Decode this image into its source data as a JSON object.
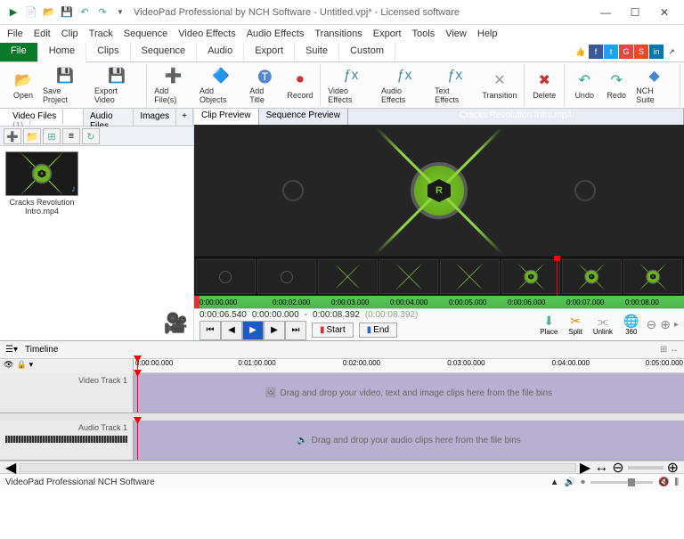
{
  "app": {
    "title": "VideoPad Professional by NCH Software - Untitled.vpj* - Licensed software"
  },
  "menu": [
    "File",
    "Edit",
    "Clip",
    "Track",
    "Sequence",
    "Video Effects",
    "Audio Effects",
    "Transitions",
    "Export",
    "Tools",
    "View",
    "Help"
  ],
  "tabs": {
    "file": "File",
    "items": [
      "Home",
      "Clips",
      "Sequence",
      "Audio",
      "Export",
      "Suite",
      "Custom"
    ],
    "active": "Home"
  },
  "ribbon": {
    "open": "Open",
    "save": "Save Project",
    "export": "Export Video",
    "addfiles": "Add File(s)",
    "addobj": "Add Objects",
    "addtitle": "Add Title",
    "record": "Record",
    "vfx": "Video Effects",
    "afx": "Audio Effects",
    "tfx": "Text Effects",
    "trans": "Transition",
    "delete": "Delete",
    "undo": "Undo",
    "redo": "Redo",
    "suite": "NCH Suite"
  },
  "bins": {
    "tabs": {
      "video": "Video Files",
      "video_count": "(1)",
      "audio": "Audio Files",
      "images": "Images"
    },
    "clip": {
      "name": "Cracks Revolution Intro.mp4"
    }
  },
  "preview": {
    "tabs": {
      "clip": "Clip Preview",
      "seq": "Sequence Preview"
    },
    "title": "Cracks Revolution Intro.mp4",
    "ruler": [
      "0:00:00.000",
      "0:00:02.000",
      "0:00:03.000",
      "0:00:04.000",
      "0:00:05.000",
      "0:00:06.000",
      "0:00:07.000",
      "0:00:08.00"
    ],
    "time": {
      "pos": "0:00:06.540",
      "in": "0:00:00.000",
      "out": "0:00:08.392",
      "dur": "(0:00:08.392)"
    },
    "start": "Start",
    "end": "End",
    "place": "Place",
    "split": "Split",
    "unlink": "Unlink",
    "v360": "360"
  },
  "timeline": {
    "label": "Timeline",
    "ruler": [
      "0:00:00.000",
      "0:01:00.000",
      "0:02:00.000",
      "0:03:00.000",
      "0:04:00.000",
      "0:05:00.000"
    ],
    "vtrack": "Video Track 1",
    "vhint": "Drag and drop your video, text and image clips here from the file bins",
    "atrack": "Audio Track 1",
    "ahint": "Drag and drop your audio clips here from the file bins"
  },
  "status": "VideoPad Professional NCH Software"
}
